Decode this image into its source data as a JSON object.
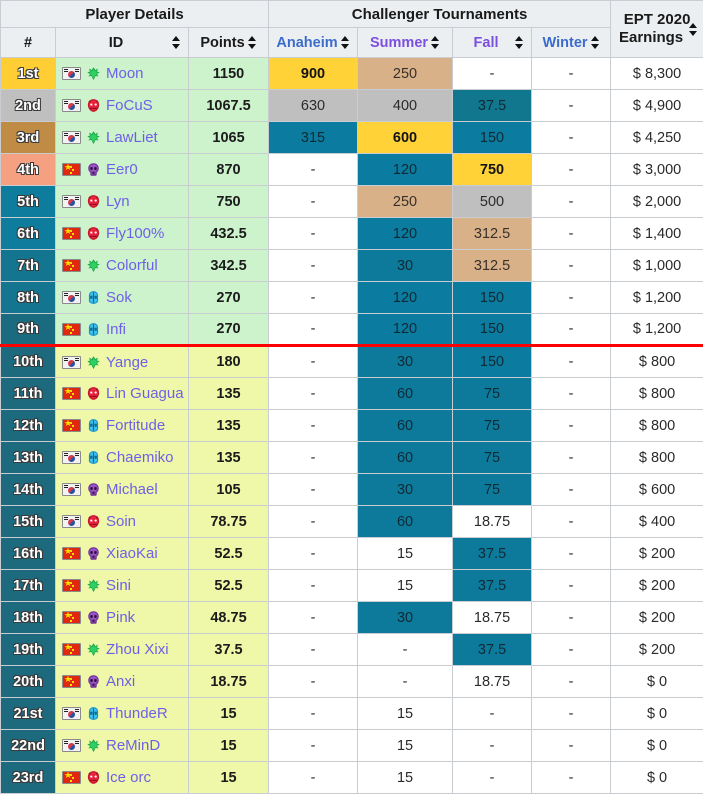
{
  "header": {
    "groups": [
      {
        "label": "Player Details",
        "span": 3
      },
      {
        "label": "Challenger Tournaments",
        "span": 4
      },
      {
        "label": "EPT 2020 Earnings",
        "span": 1,
        "rowspan": true
      }
    ],
    "columns": [
      {
        "key": "rank",
        "label": "#",
        "sortable": false,
        "color": "dark"
      },
      {
        "key": "id",
        "label": "ID",
        "sortable": true,
        "color": "dark"
      },
      {
        "key": "points",
        "label": "Points",
        "sortable": true,
        "color": "dark"
      },
      {
        "key": "anaheim",
        "label": "Anaheim",
        "sortable": true,
        "color": "blue"
      },
      {
        "key": "summer",
        "label": "Summer",
        "sortable": true,
        "color": "purple"
      },
      {
        "key": "fall",
        "label": "Fall",
        "sortable": true,
        "color": "purple"
      },
      {
        "key": "winter",
        "label": "Winter",
        "sortable": true,
        "color": "blue"
      },
      {
        "key": "earnings",
        "label": "EPT 2020 Earnings",
        "sortable": true,
        "color": "dark"
      }
    ],
    "sort_icon": "sort-updown-icon"
  },
  "colors": {
    "gold": "#ffd338",
    "silver": "#bfbfbf",
    "bronze": "#d8b189",
    "teal": "#0c7ba0",
    "rank_4th": "#f5a181",
    "row_top": "#cdf3cd",
    "row_low": "#eef8a8",
    "separator": "#ff0000",
    "player_name": "#6f5fe8",
    "header_blue": "#3b6ccc",
    "header_purple": "#7b4fe0"
  },
  "separator_after_rank": 9,
  "rows": [
    {
      "rank": "1st",
      "rank_style": "rk-gold",
      "flag": "kr",
      "race": "nightelf",
      "name": "Moon",
      "points": "1150",
      "anaheim": "900",
      "anaheim_hl": "gold",
      "summer": "250",
      "summer_hl": "bronze",
      "fall": "-",
      "fall_hl": "",
      "winter": "-",
      "winter_hl": "",
      "earnings": "$ 8,300"
    },
    {
      "rank": "2nd",
      "rank_style": "rk-silver",
      "flag": "kr",
      "race": "orc",
      "name": "FoCuS",
      "points": "1067.5",
      "anaheim": "630",
      "anaheim_hl": "silver",
      "summer": "400",
      "summer_hl": "silver",
      "fall": "37.5",
      "fall_hl": "t3",
      "winter": "-",
      "winter_hl": "",
      "earnings": "$ 4,900"
    },
    {
      "rank": "3rd",
      "rank_style": "rk-bronze",
      "flag": "kr",
      "race": "nightelf",
      "name": "LawLiet",
      "points": "1065",
      "anaheim": "315",
      "anaheim_hl": "t1",
      "summer": "600",
      "summer_hl": "gold",
      "fall": "150",
      "fall_hl": "t1",
      "winter": "-",
      "winter_hl": "",
      "earnings": "$ 4,250"
    },
    {
      "rank": "4th",
      "rank_style": "rk-4",
      "flag": "cn",
      "race": "undead",
      "name": "Eer0",
      "points": "870",
      "anaheim": "-",
      "anaheim_hl": "",
      "summer": "120",
      "summer_hl": "t1",
      "fall": "750",
      "fall_hl": "gold",
      "winter": "-",
      "winter_hl": "",
      "earnings": "$ 3,000"
    },
    {
      "rank": "5th",
      "rank_style": "rk-t1",
      "flag": "kr",
      "race": "orc",
      "name": "Lyn",
      "points": "750",
      "anaheim": "-",
      "anaheim_hl": "",
      "summer": "250",
      "summer_hl": "bronze",
      "fall": "500",
      "fall_hl": "silver",
      "winter": "-",
      "winter_hl": "",
      "earnings": "$ 2,000"
    },
    {
      "rank": "6th",
      "rank_style": "rk-t1",
      "flag": "cn",
      "race": "orc",
      "name": "Fly100%",
      "points": "432.5",
      "anaheim": "-",
      "anaheim_hl": "",
      "summer": "120",
      "summer_hl": "t1",
      "fall": "312.5",
      "fall_hl": "bronze",
      "winter": "-",
      "winter_hl": "",
      "earnings": "$ 1,400"
    },
    {
      "rank": "7th",
      "rank_style": "rk-t2",
      "flag": "cn",
      "race": "nightelf",
      "name": "Colorful",
      "points": "342.5",
      "anaheim": "-",
      "anaheim_hl": "",
      "summer": "30",
      "summer_hl": "t2",
      "fall": "312.5",
      "fall_hl": "bronze",
      "winter": "-",
      "winter_hl": "",
      "earnings": "$ 1,000"
    },
    {
      "rank": "8th",
      "rank_style": "rk-t2",
      "flag": "kr",
      "race": "human",
      "name": "Sok",
      "points": "270",
      "anaheim": "-",
      "anaheim_hl": "",
      "summer": "120",
      "summer_hl": "t1",
      "fall": "150",
      "fall_hl": "t1",
      "winter": "-",
      "winter_hl": "",
      "earnings": "$ 1,200"
    },
    {
      "rank": "9th",
      "rank_style": "rk-t3",
      "flag": "cn",
      "race": "human",
      "name": "Infi",
      "points": "270",
      "anaheim": "-",
      "anaheim_hl": "",
      "summer": "120",
      "summer_hl": "t1",
      "fall": "150",
      "fall_hl": "t1",
      "winter": "-",
      "winter_hl": "",
      "earnings": "$ 1,200"
    },
    {
      "rank": "10th",
      "rank_style": "rk-low",
      "low": true,
      "flag": "kr",
      "race": "nightelf",
      "name": "Yange",
      "points": "180",
      "anaheim": "-",
      "anaheim_hl": "",
      "summer": "30",
      "summer_hl": "t2",
      "fall": "150",
      "fall_hl": "t1",
      "winter": "-",
      "winter_hl": "",
      "earnings": "$ 800"
    },
    {
      "rank": "11th",
      "rank_style": "rk-low",
      "low": true,
      "flag": "cn",
      "race": "orc",
      "name": "Lin Guagua",
      "points": "135",
      "anaheim": "-",
      "anaheim_hl": "",
      "summer": "60",
      "summer_hl": "t2",
      "fall": "75",
      "fall_hl": "t2",
      "winter": "-",
      "winter_hl": "",
      "earnings": "$ 800"
    },
    {
      "rank": "12th",
      "rank_style": "rk-low",
      "low": true,
      "flag": "cn",
      "race": "human",
      "name": "Fortitude",
      "points": "135",
      "anaheim": "-",
      "anaheim_hl": "",
      "summer": "60",
      "summer_hl": "t2",
      "fall": "75",
      "fall_hl": "t2",
      "winter": "-",
      "winter_hl": "",
      "earnings": "$ 800"
    },
    {
      "rank": "13th",
      "rank_style": "rk-low",
      "low": true,
      "flag": "kr",
      "race": "human",
      "name": "Chaemiko",
      "points": "135",
      "anaheim": "-",
      "anaheim_hl": "",
      "summer": "60",
      "summer_hl": "t2",
      "fall": "75",
      "fall_hl": "t2",
      "winter": "-",
      "winter_hl": "",
      "earnings": "$ 800"
    },
    {
      "rank": "14th",
      "rank_style": "rk-low",
      "low": true,
      "flag": "kr",
      "race": "undead",
      "name": "Michael",
      "points": "105",
      "anaheim": "-",
      "anaheim_hl": "",
      "summer": "30",
      "summer_hl": "t2",
      "fall": "75",
      "fall_hl": "t2",
      "winter": "-",
      "winter_hl": "",
      "earnings": "$ 600"
    },
    {
      "rank": "15th",
      "rank_style": "rk-low",
      "low": true,
      "flag": "kr",
      "race": "orc",
      "name": "Soin",
      "points": "78.75",
      "anaheim": "-",
      "anaheim_hl": "",
      "summer": "60",
      "summer_hl": "t2",
      "fall": "18.75",
      "fall_hl": "",
      "winter": "-",
      "winter_hl": "",
      "earnings": "$ 400"
    },
    {
      "rank": "16th",
      "rank_style": "rk-low",
      "low": true,
      "flag": "cn",
      "race": "undead",
      "name": "XiaoKai",
      "points": "52.5",
      "anaheim": "-",
      "anaheim_hl": "",
      "summer": "15",
      "summer_hl": "",
      "fall": "37.5",
      "fall_hl": "t2",
      "winter": "-",
      "winter_hl": "",
      "earnings": "$ 200"
    },
    {
      "rank": "17th",
      "rank_style": "rk-low",
      "low": true,
      "flag": "cn",
      "race": "nightelf",
      "name": "Sini",
      "points": "52.5",
      "anaheim": "-",
      "anaheim_hl": "",
      "summer": "15",
      "summer_hl": "",
      "fall": "37.5",
      "fall_hl": "t2",
      "winter": "-",
      "winter_hl": "",
      "earnings": "$ 200"
    },
    {
      "rank": "18th",
      "rank_style": "rk-low",
      "low": true,
      "flag": "cn",
      "race": "undead",
      "name": "Pink",
      "points": "48.75",
      "anaheim": "-",
      "anaheim_hl": "",
      "summer": "30",
      "summer_hl": "t2",
      "fall": "18.75",
      "fall_hl": "",
      "winter": "-",
      "winter_hl": "",
      "earnings": "$ 200"
    },
    {
      "rank": "19th",
      "rank_style": "rk-low",
      "low": true,
      "flag": "cn",
      "race": "nightelf",
      "name": "Zhou Xixi",
      "points": "37.5",
      "anaheim": "-",
      "anaheim_hl": "",
      "summer": "-",
      "summer_hl": "",
      "fall": "37.5",
      "fall_hl": "t2",
      "winter": "-",
      "winter_hl": "",
      "earnings": "$ 200"
    },
    {
      "rank": "20th",
      "rank_style": "rk-low",
      "low": true,
      "flag": "cn",
      "race": "undead",
      "name": "Anxi",
      "points": "18.75",
      "anaheim": "-",
      "anaheim_hl": "",
      "summer": "-",
      "summer_hl": "",
      "fall": "18.75",
      "fall_hl": "",
      "winter": "-",
      "winter_hl": "",
      "earnings": "$ 0"
    },
    {
      "rank": "21st",
      "rank_style": "rk-low",
      "low": true,
      "flag": "kr",
      "race": "human",
      "name": "ThundeR",
      "points": "15",
      "anaheim": "-",
      "anaheim_hl": "",
      "summer": "15",
      "summer_hl": "",
      "fall": "-",
      "fall_hl": "",
      "winter": "-",
      "winter_hl": "",
      "earnings": "$ 0"
    },
    {
      "rank": "22nd",
      "rank_style": "rk-low",
      "low": true,
      "flag": "kr",
      "race": "nightelf",
      "name": "ReMinD",
      "points": "15",
      "anaheim": "-",
      "anaheim_hl": "",
      "summer": "15",
      "summer_hl": "",
      "fall": "-",
      "fall_hl": "",
      "winter": "-",
      "winter_hl": "",
      "earnings": "$ 0"
    },
    {
      "rank": "23rd",
      "rank_style": "rk-low",
      "low": true,
      "flag": "cn",
      "race": "orc",
      "name": "Ice orc",
      "points": "15",
      "anaheim": "-",
      "anaheim_hl": "",
      "summer": "15",
      "summer_hl": "",
      "fall": "-",
      "fall_hl": "",
      "winter": "-",
      "winter_hl": "",
      "earnings": "$ 0"
    }
  ]
}
